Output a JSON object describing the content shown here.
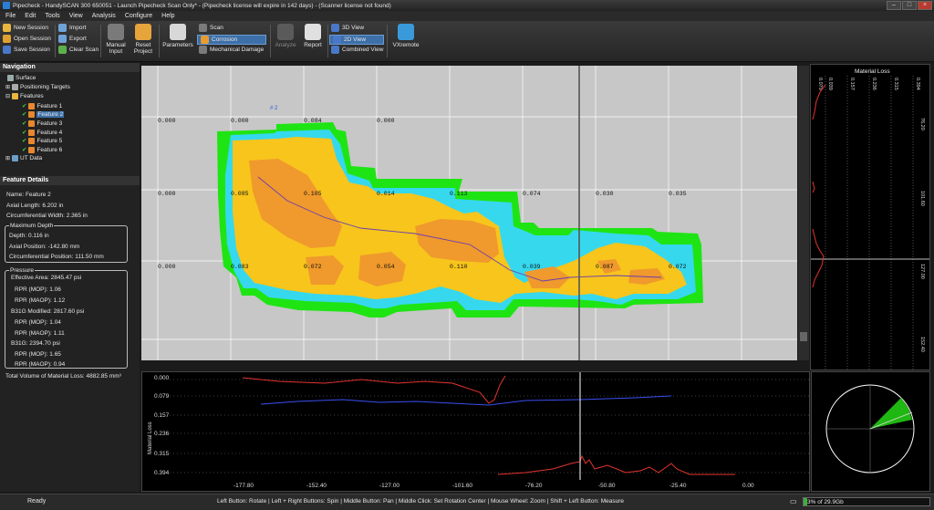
{
  "window": {
    "title": "Pipecheck - HandySCAN 300 650051 - Launch Pipecheck Scan Only* - (Pipecheck license will expire in 142 days) - (Scanner license not found)"
  },
  "menu": [
    "File",
    "Edit",
    "Tools",
    "View",
    "Analysis",
    "Configure",
    "Help"
  ],
  "ribbon": {
    "session": [
      "New Session",
      "Open Session",
      "Save Session"
    ],
    "data": [
      "Import",
      "Export",
      "Clear Scan"
    ],
    "manual_input": "Manual\nInput",
    "reset_project": "Reset\nProject",
    "parameters": "Parameters",
    "modes": [
      "Scan",
      "Corrosion",
      "Mechanical Damage"
    ],
    "analyze": "Analyze",
    "report": "Report",
    "views": [
      "3D View",
      "2D View",
      "Combined View"
    ],
    "vxremote": "VXremote"
  },
  "navigation": {
    "title": "Navigation",
    "items": [
      "Surface",
      "Positioning Targets",
      "Features",
      "Feature 1",
      "Feature 2",
      "Feature 3",
      "Feature 4",
      "Feature 5",
      "Feature 6",
      "UT Data"
    ]
  },
  "details": {
    "title": "Feature Details",
    "name": "Name: Feature 2",
    "axial_length": "Axial Length: 6.202 in",
    "circ_width": "Circumferential Width: 2.365 in",
    "max_depth_title": "Maximum Depth",
    "depth": "Depth: 0.116 in",
    "axial_position": "Axial Position: -142.80 mm",
    "circ_position": "Circumferential Position: 111.50 mm",
    "pressure_title": "Pressure",
    "effective_area": "Effective Area: 2845.47 psi",
    "ea_rpr_mop": "RPR (MOP): 1.06",
    "ea_rpr_maop": "RPR (MAOP): 1.12",
    "b31g_modified": "B31G Modified: 2817.60 psi",
    "bm_rpr_mop": "RPR (MOP): 1.04",
    "bm_rpr_maop": "RPR (MAOP): 1.11",
    "b31g": "B31G: 2394.70 psi",
    "b_rpr_mop": "RPR (MOP): 1.65",
    "b_rpr_maop": "RPR (MAOP): 0.94",
    "total_volume": "Total Volume of Material Loss: 4882.85 mm³"
  },
  "view2d": {
    "feature_tag": "# 2",
    "grid_labels": [
      [
        "0.000",
        "0.000",
        "0.084",
        "0.000"
      ],
      [
        "0.000",
        "0.085",
        "0.105",
        "0.014",
        "0.113",
        "0.074",
        "0.030",
        "0.035"
      ],
      [
        "0.000",
        "0.083",
        "0.072",
        "0.054",
        "0.110",
        "0.039",
        "0.087",
        "0.072"
      ]
    ]
  },
  "right_strip": {
    "title": "Material Loss",
    "col_labels": [
      "0.039",
      "0.157",
      "0.236",
      "0.315",
      "0.394"
    ],
    "first_label": "0.079",
    "axis_labels": [
      "76.20",
      "101.60",
      "127.00",
      "152.40"
    ]
  },
  "profile": {
    "ylabel": "Material Loss",
    "y_ticks": [
      "0.000",
      "0.079",
      "0.157",
      "0.236",
      "0.315",
      "0.394"
    ],
    "x_ticks": [
      "-177.80",
      "-152.40",
      "-127.00",
      "-101.60",
      "-76.20",
      "-50.80",
      "-25.40",
      "0.00"
    ]
  },
  "status": {
    "ready": "Ready",
    "hint": "Left Button: Rotate  |  Left + Right Buttons: Spin  |  Middle Button: Pan  |  Middle Click: Set Rotation Center  |  Mouse Wheel: Zoom  |  Shift + Left Button: Measure",
    "memory": "3% of 29.9Gb"
  },
  "colors": {
    "accent": "#3d6fa8",
    "loss_green": "#1edc12",
    "loss_cyan": "#35d7f0",
    "loss_yellow": "#f7c51c",
    "loss_orange": "#f19c2c",
    "profile_red": "#e3342f",
    "profile_blue": "#3a4ff0"
  }
}
